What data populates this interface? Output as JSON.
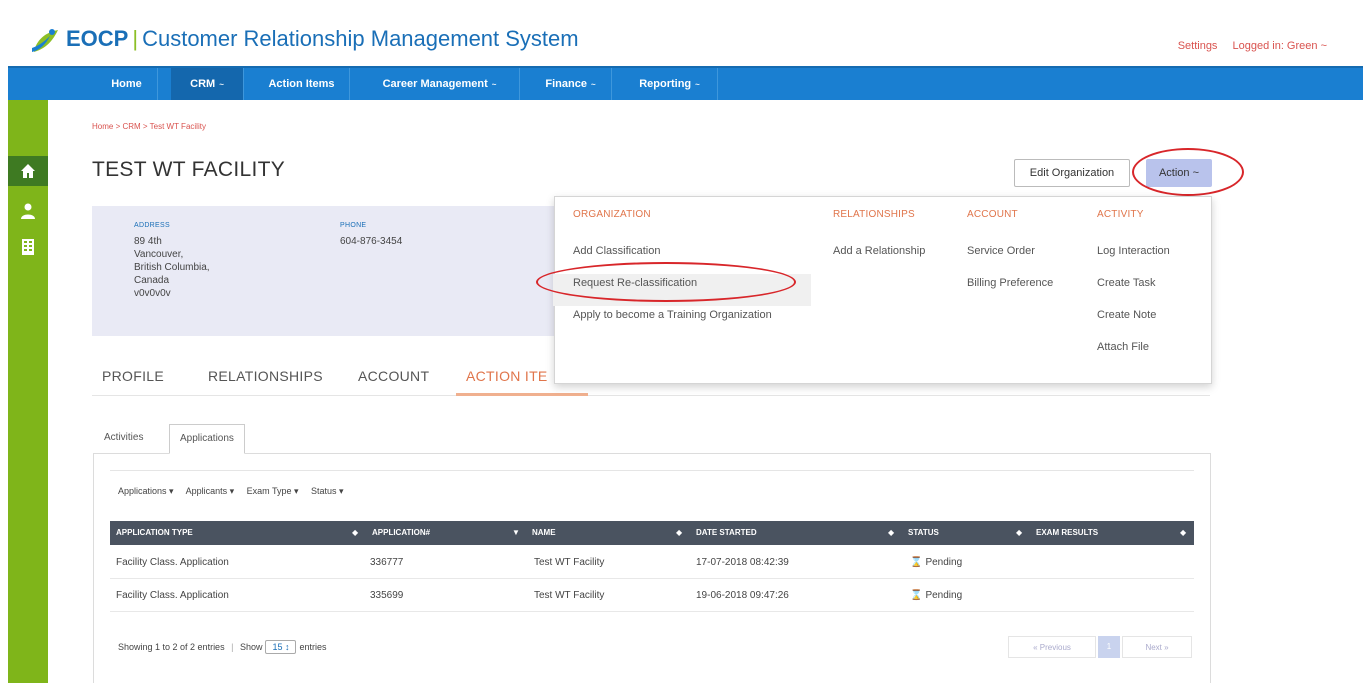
{
  "header": {
    "brand": "EOCP",
    "separator": "|",
    "title": "Customer Relationship Management System",
    "settings": "Settings",
    "logged_in": "Logged in: Green ~"
  },
  "nav": [
    {
      "label": "Home",
      "caret": ""
    },
    {
      "label": "CRM",
      "caret": "~"
    },
    {
      "label": "Action Items",
      "caret": ""
    },
    {
      "label": "Career Management",
      "caret": "~"
    },
    {
      "label": "Finance",
      "caret": "~"
    },
    {
      "label": "Reporting",
      "caret": "~"
    }
  ],
  "sidebar": {
    "icons": [
      "home-icon",
      "user-icon",
      "building-icon"
    ]
  },
  "breadcrumb": "Home > CRM > Test WT Facility",
  "page": {
    "title": "TEST WT FACILITY",
    "edit_button": "Edit Organization",
    "action_button": "Action ~"
  },
  "info": {
    "address_label": "ADDRESS",
    "address_lines": [
      "89 4th",
      "Vancouver,",
      "British Columbia,",
      "Canada",
      "v0v0v0v"
    ],
    "phone_label": "PHONE",
    "phone": "604-876-3454"
  },
  "dropdown": {
    "organization": {
      "heading": "ORGANIZATION",
      "items": [
        "Add Classification",
        "Request Re-classification",
        "Apply to become a Training Organization"
      ]
    },
    "relationships": {
      "heading": "RELATIONSHIPS",
      "items": [
        "Add a Relationship"
      ]
    },
    "account": {
      "heading": "ACCOUNT",
      "items": [
        "Service Order",
        "Billing Preference"
      ]
    },
    "activity": {
      "heading": "ACTIVITY",
      "items": [
        "Log Interaction",
        "Create Task",
        "Create Note",
        "Attach File"
      ]
    }
  },
  "tabs": [
    "PROFILE",
    "RELATIONSHIPS",
    "ACCOUNT",
    "ACTION ITE"
  ],
  "subtabs": [
    "Activities",
    "Applications"
  ],
  "filters": [
    "Applications ▾",
    "Applicants ▾",
    "Exam Type ▾",
    "Status ▾"
  ],
  "table": {
    "columns": [
      "APPLICATION TYPE",
      "APPLICATION#",
      "NAME",
      "DATE STARTED",
      "STATUS",
      "EXAM RESULTS"
    ],
    "rows": [
      {
        "type": "Facility Class. Application",
        "number": "336777",
        "name": "Test WT Facility",
        "date": "17-07-2018 08:42:39",
        "status": "Pending",
        "exam": ""
      },
      {
        "type": "Facility Class. Application",
        "number": "335699",
        "name": "Test WT Facility",
        "date": "19-06-2018 09:47:26",
        "status": "Pending",
        "exam": ""
      }
    ]
  },
  "footer": {
    "showing": "Showing 1 to 2 of 2 entries",
    "show_label": "Show",
    "page_size": "15 ↕",
    "entries_label": "entries",
    "previous": "« Previous",
    "page": "1",
    "next": "Next »"
  },
  "colors": {
    "nav_blue": "#1a7fd1",
    "sidebar_green": "#7fb51a",
    "accent_orange": "#e0754b",
    "annotation_red": "#d8262a",
    "action_button": "#b9c3ec"
  }
}
